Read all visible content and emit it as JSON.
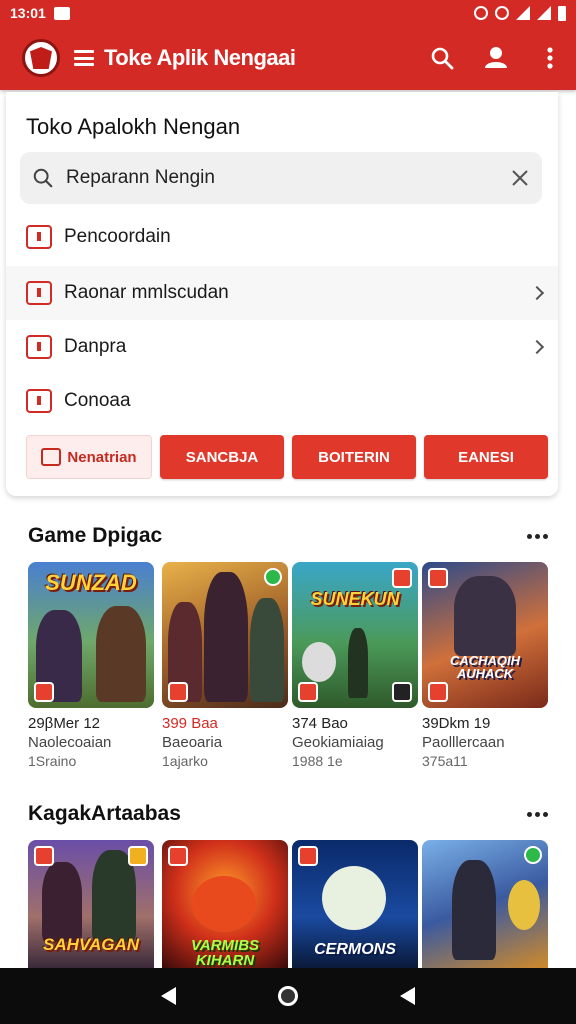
{
  "status_bar": {
    "time": "13:01"
  },
  "app_bar": {
    "title": "Toke Aplik Nengaai"
  },
  "panel": {
    "title": "Toko Apalokh Nengan",
    "search_value": "Reparann Nengin",
    "items": [
      {
        "label": "Pencoordain"
      },
      {
        "label": "Raonar mmlscudan"
      },
      {
        "label": "Danpra"
      },
      {
        "label": "Conoaa"
      }
    ],
    "buttons": [
      "Nenatrian",
      "SANCBJA",
      "BOITERIN",
      "EANESI"
    ]
  },
  "section1": {
    "title": "Game Dpigac",
    "games": [
      {
        "art": "SUNZAD",
        "price": "29βMer 12",
        "sub": "Naolecoaian",
        "num": "1Sraino"
      },
      {
        "art": "",
        "price": "399 Baa",
        "sub": "Baeoaria",
        "num": "1ajarko"
      },
      {
        "art": "SUNEKUN",
        "price": "374 Bao",
        "sub": "Geokiamiaiag",
        "num": "1988 1e"
      },
      {
        "art": "CACHAQIH AUHACK",
        "price": "39Dkm 19",
        "sub": "Paolllercaan",
        "num": "375a11"
      }
    ]
  },
  "section2": {
    "title": "KagakArtaabas",
    "games": [
      {
        "art": "SAHVAGAN"
      },
      {
        "art": "VARMIBS KIHARN"
      },
      {
        "art": "CERMONS"
      },
      {
        "art": ""
      }
    ]
  },
  "colors": {
    "brand": "#d42a25",
    "accent_button": "#e0392c",
    "price_red": "#d42a25"
  }
}
